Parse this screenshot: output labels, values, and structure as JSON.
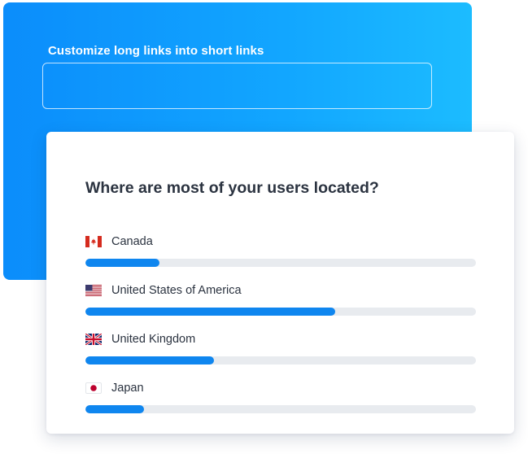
{
  "shortener": {
    "label": "Customize long links into short links",
    "input_value": "",
    "input_placeholder": ""
  },
  "poll": {
    "question": "Where are most of your users located?",
    "options": [
      {
        "country": "Canada",
        "flag_icon": "canada-flag-icon",
        "share_percent": 19
      },
      {
        "country": "United States of America",
        "flag_icon": "usa-flag-icon",
        "share_percent": 64
      },
      {
        "country": "United Kingdom",
        "flag_icon": "uk-flag-icon",
        "share_percent": 33
      },
      {
        "country": "Japan",
        "flag_icon": "japan-flag-icon",
        "share_percent": 15
      }
    ]
  },
  "colors": {
    "accent": "#0f86ef",
    "track": "#e8ebef",
    "gradient_start": "#0b8dfb",
    "gradient_end": "#1cbcff",
    "text": "#2b3340"
  }
}
